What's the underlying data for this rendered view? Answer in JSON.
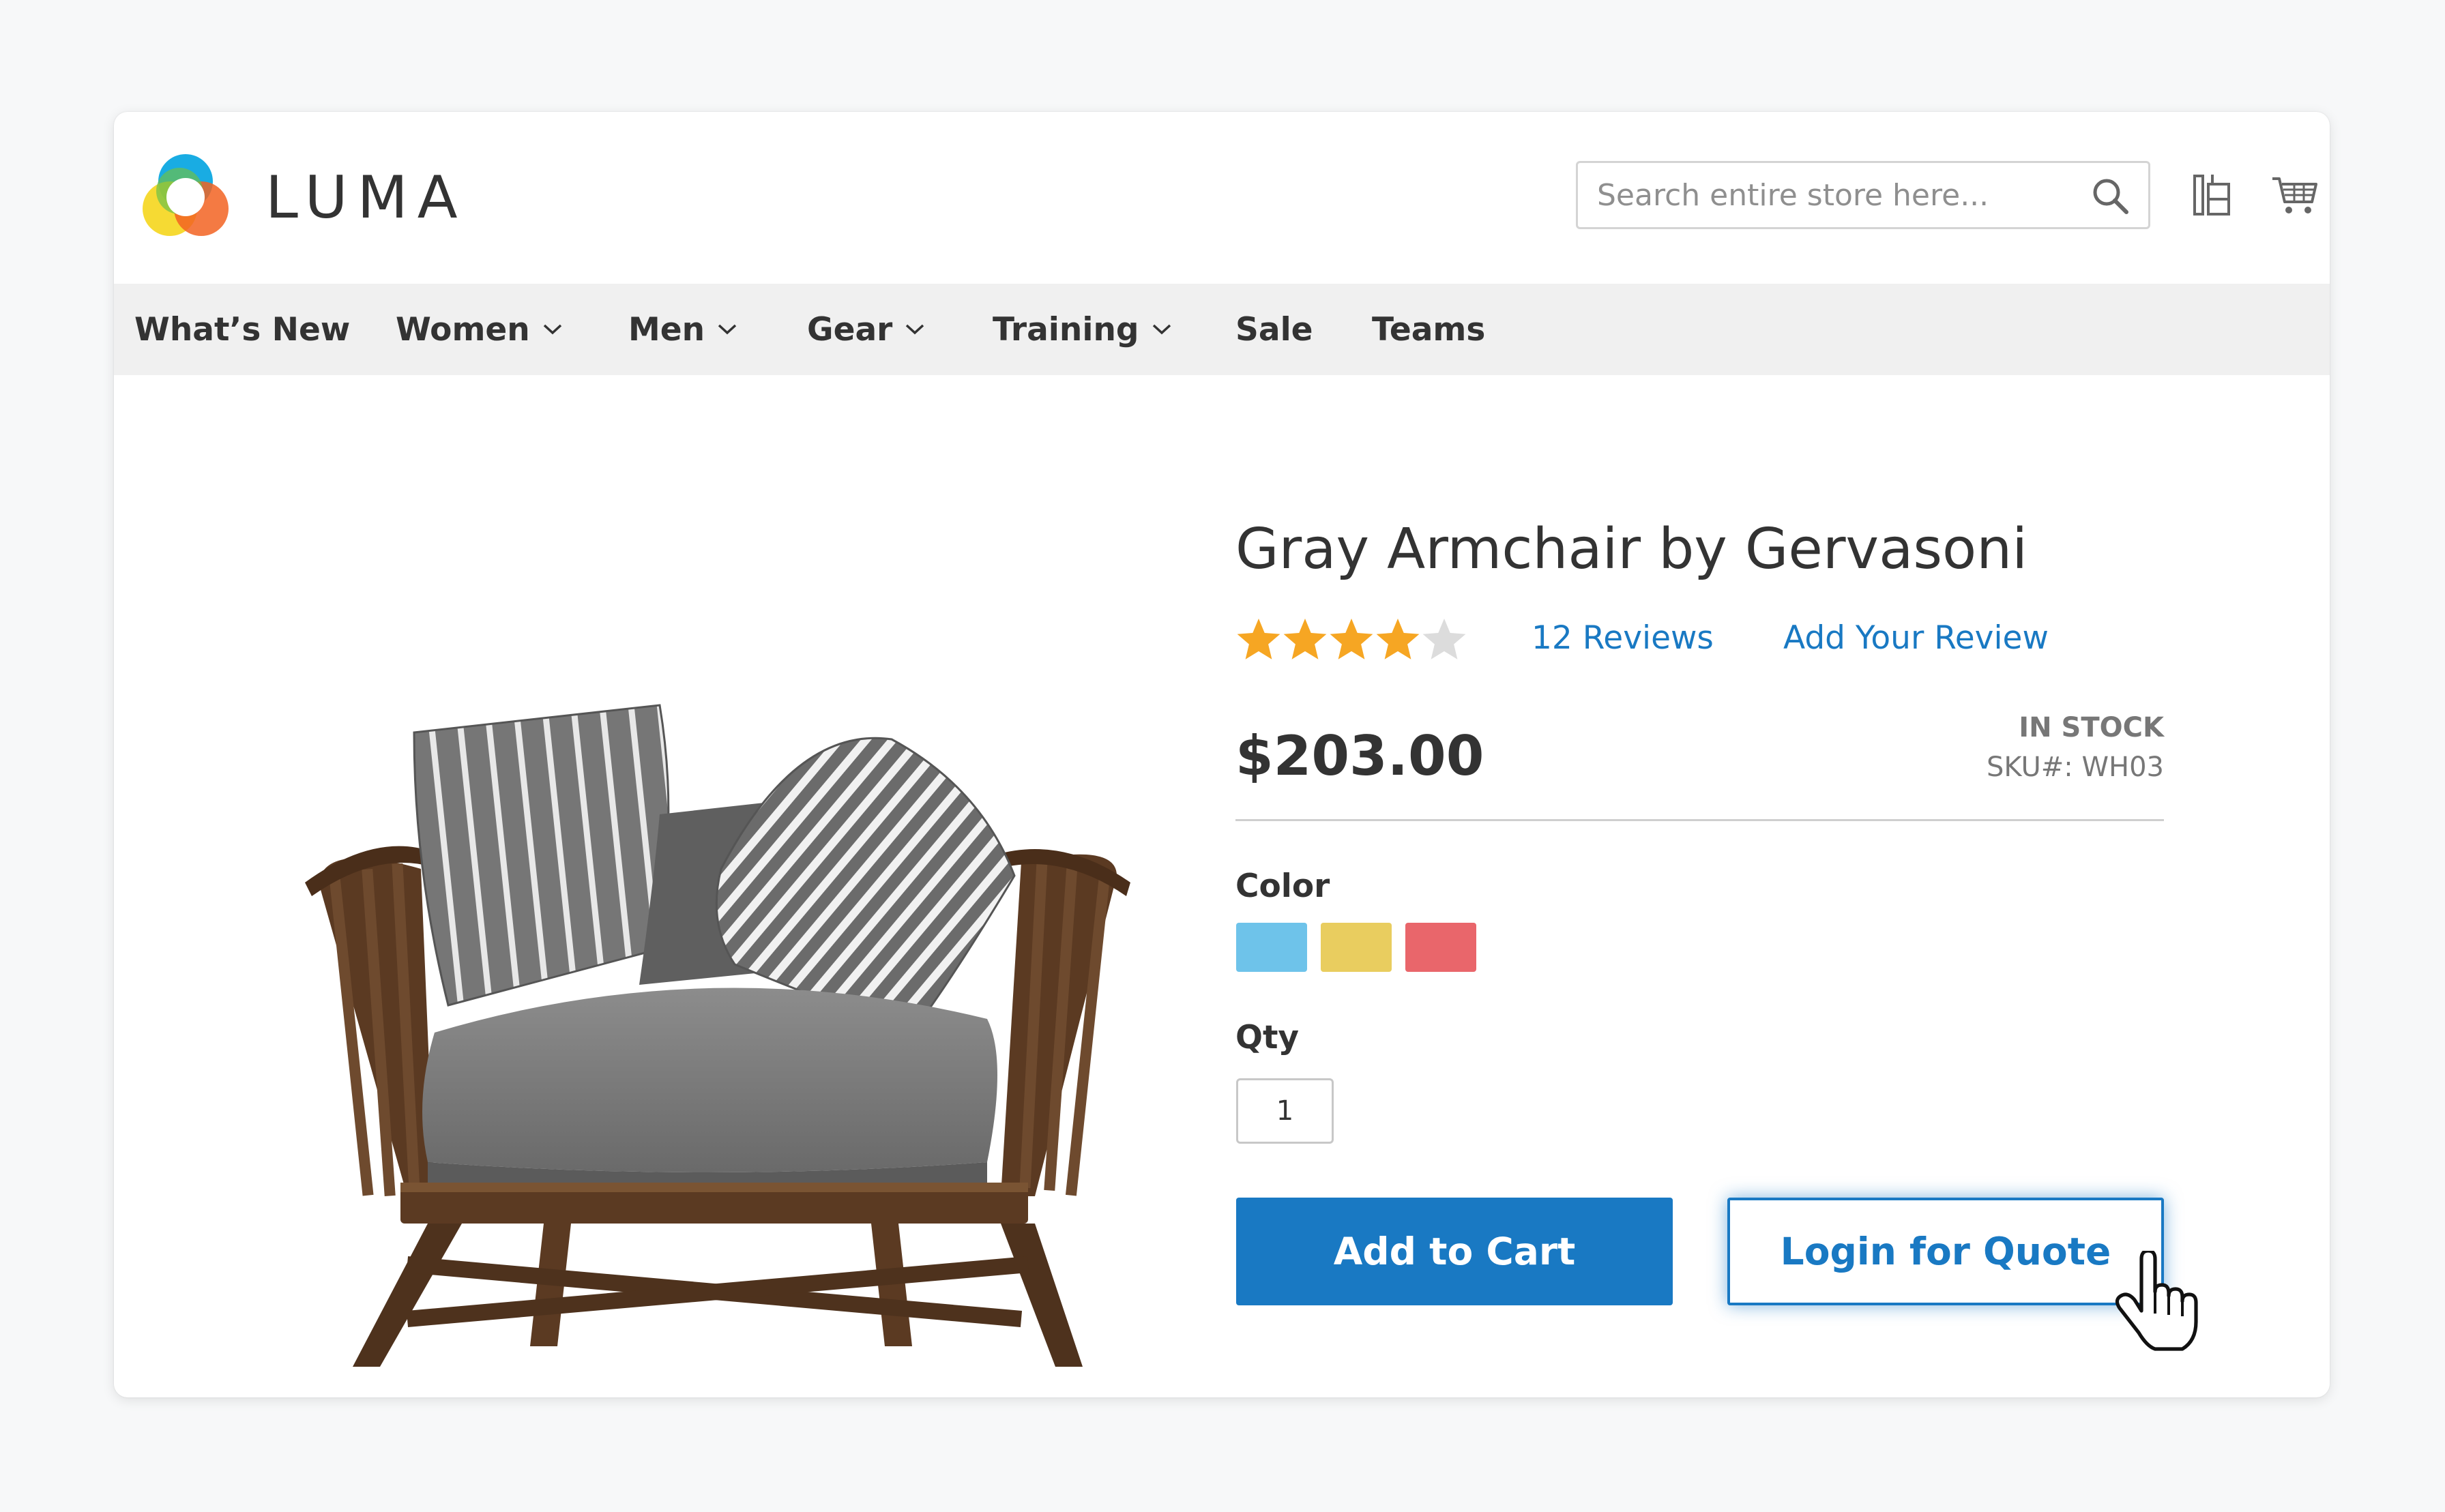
{
  "brand": {
    "name": "LUMA"
  },
  "header": {
    "search_placeholder": "Search entire store here...",
    "search_icon": "search-icon",
    "compare_icon": "compare-icon",
    "cart_icon": "cart-icon"
  },
  "nav": {
    "items": [
      {
        "label": "What’s New",
        "has_dropdown": false
      },
      {
        "label": "Women",
        "has_dropdown": true
      },
      {
        "label": "Men",
        "has_dropdown": true
      },
      {
        "label": "Gear",
        "has_dropdown": true
      },
      {
        "label": "Training",
        "has_dropdown": true
      },
      {
        "label": "Sale",
        "has_dropdown": false
      },
      {
        "label": "Teams",
        "has_dropdown": false
      }
    ]
  },
  "product": {
    "title": "Gray Armchair by Gervasoni",
    "rating": {
      "value": 4,
      "max": 5
    },
    "reviews_link": "12 Reviews",
    "add_review_link": "Add Your Review",
    "price": "$203.00",
    "stock": "IN STOCK",
    "sku": "SKU#: WH03",
    "color_label": "Color",
    "colors": [
      "#6ec3ea",
      "#e9cd5f",
      "#e9666b"
    ],
    "qty_label": "Qty",
    "qty_value": "1",
    "add_to_cart_label": "Add to Cart",
    "login_quote_label": "Login for Quote"
  },
  "colors": {
    "accent": "#1979c3",
    "star_filled": "#f6a623",
    "star_empty": "#dcdcdc",
    "nav_bg": "#f0f0f0"
  }
}
